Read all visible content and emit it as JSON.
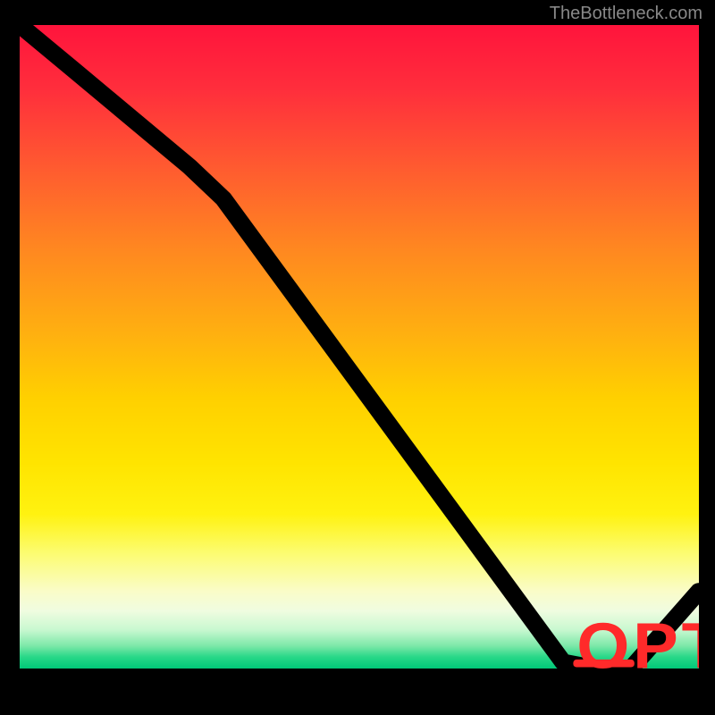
{
  "watermark": "TheBottleneck.com",
  "chart_data": {
    "type": "line",
    "title": "",
    "xlabel": "",
    "ylabel": "",
    "xlim": [
      0,
      100
    ],
    "ylim": [
      0,
      100
    ],
    "grid": false,
    "curve": {
      "x": [
        0,
        8,
        25,
        30,
        80,
        85,
        90,
        100
      ],
      "y_bottleneck": [
        100,
        93,
        78,
        73,
        1,
        0,
        0,
        12
      ]
    },
    "marker": {
      "x": 86,
      "y": 0,
      "label": "OPTIMUM"
    },
    "background_gradient_desc": "vertical red-yellow-green heatmap (red high, green low)"
  }
}
